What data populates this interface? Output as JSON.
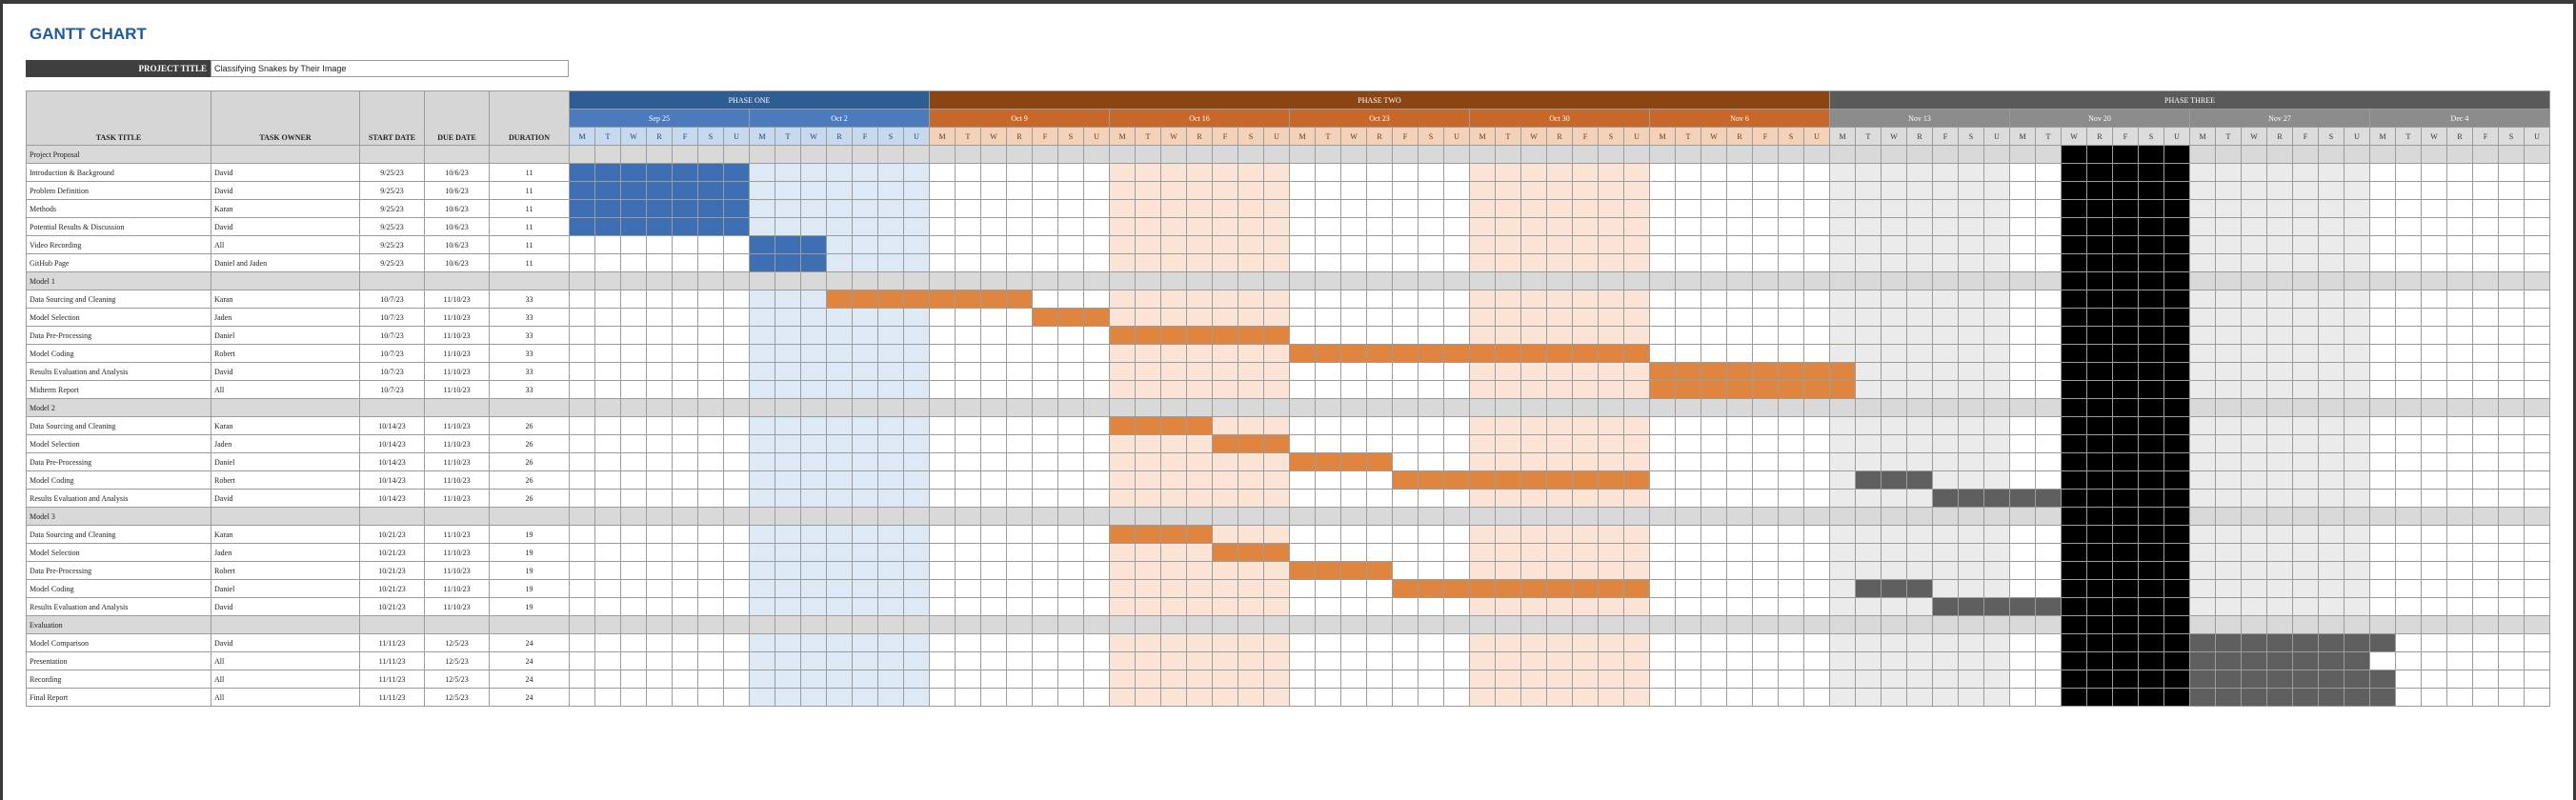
{
  "title": "GANTT CHART",
  "project_title_label": "PROJECT TITLE",
  "project_title_value": "Classifying Snakes by Their Image",
  "columns": {
    "task_title": "TASK TITLE",
    "task_owner": "TASK OWNER",
    "start_date": "START DATE",
    "due_date": "DUE DATE",
    "duration": "DURATION"
  },
  "day_letters": [
    "M",
    "T",
    "W",
    "R",
    "F",
    "S",
    "U"
  ],
  "phases": [
    {
      "label": "PHASE ONE",
      "weeks": 2,
      "style": "ph1"
    },
    {
      "label": "PHASE TWO",
      "weeks": 5,
      "style": "ph2"
    },
    {
      "label": "PHASE THREE",
      "weeks": 4,
      "style": "ph3"
    }
  ],
  "weeks": [
    {
      "label": "Sep 25",
      "phase": 1,
      "col_style": "blue"
    },
    {
      "label": "Oct 2",
      "phase": 1,
      "col_style": "lightblue"
    },
    {
      "label": "Oct 9",
      "phase": 2,
      "col_style": "white"
    },
    {
      "label": "Oct 16",
      "phase": 2,
      "col_style": "peach"
    },
    {
      "label": "Oct 23",
      "phase": 2,
      "col_style": "white"
    },
    {
      "label": "Oct 30",
      "phase": 2,
      "col_style": "peach"
    },
    {
      "label": "Nov 6",
      "phase": 2,
      "col_style": "white"
    },
    {
      "label": "Nov 13",
      "phase": 3,
      "col_style": "gray"
    },
    {
      "label": "Nov 20",
      "phase": 3,
      "col_style": "white"
    },
    {
      "label": "Nov 27",
      "phase": 3,
      "col_style": "gray"
    },
    {
      "label": "Dec 4",
      "phase": 3,
      "col_style": "white"
    }
  ],
  "colors": {
    "phase_one_bar": "#3f6fb3",
    "phase_two_bar": "#e0853f",
    "phase_three_bar": "#5f5f5f",
    "blackout": "#000000",
    "shade_blue": "#dde9f5",
    "shade_peach": "#fbe4d5",
    "shade_gray": "#ebebeb"
  },
  "blackout_days": "Nov 22 - Nov 26",
  "rows": [
    {
      "type": "section",
      "title": "Project Proposal"
    },
    {
      "type": "task",
      "title": "Introduction & Background",
      "owner": "David",
      "start": "9/25/23",
      "due": "10/6/23",
      "duration": "11",
      "bar": [
        0,
        7
      ],
      "color": "phase_one_bar"
    },
    {
      "type": "task",
      "title": "Problem Definition",
      "owner": "David",
      "start": "9/25/23",
      "due": "10/6/23",
      "duration": "11",
      "bar": [
        0,
        7
      ],
      "color": "phase_one_bar"
    },
    {
      "type": "task",
      "title": "Methods",
      "owner": "Karan",
      "start": "9/25/23",
      "due": "10/6/23",
      "duration": "11",
      "bar": [
        0,
        7
      ],
      "color": "phase_one_bar"
    },
    {
      "type": "task",
      "title": "Potential Results & Discussion",
      "owner": "David",
      "start": "9/25/23",
      "due": "10/6/23",
      "duration": "11",
      "bar": [
        0,
        7
      ],
      "color": "phase_one_bar"
    },
    {
      "type": "task",
      "title": "Video Recording",
      "owner": "All",
      "start": "9/25/23",
      "due": "10/6/23",
      "duration": "11",
      "bar": [
        7,
        10
      ],
      "color": "phase_one_bar"
    },
    {
      "type": "task",
      "title": "GitHub Page",
      "owner": "Daniel and Jaden",
      "start": "9/25/23",
      "due": "10/6/23",
      "duration": "11",
      "bar": [
        7,
        10
      ],
      "color": "phase_one_bar"
    },
    {
      "type": "section",
      "title": "Model 1"
    },
    {
      "type": "task",
      "title": "Data Sourcing and Cleaning",
      "owner": "Karan",
      "start": "10/7/23",
      "due": "11/10/23",
      "duration": "33",
      "bar": [
        10,
        18
      ],
      "color": "phase_two_bar"
    },
    {
      "type": "task",
      "title": "Model Selection",
      "owner": "Jaden",
      "start": "10/7/23",
      "due": "11/10/23",
      "duration": "33",
      "bar": [
        18,
        21
      ],
      "color": "phase_two_bar"
    },
    {
      "type": "task",
      "title": "Data Pre-Processing",
      "owner": "Daniel",
      "start": "10/7/23",
      "due": "11/10/23",
      "duration": "33",
      "bar": [
        21,
        28
      ],
      "color": "phase_two_bar"
    },
    {
      "type": "task",
      "title": "Model Coding",
      "owner": "Robert",
      "start": "10/7/23",
      "due": "11/10/23",
      "duration": "33",
      "bar": [
        28,
        42
      ],
      "color": "phase_two_bar"
    },
    {
      "type": "task",
      "title": "Results Evaluation and Analysis",
      "owner": "David",
      "start": "10/7/23",
      "due": "11/10/23",
      "duration": "33",
      "bar": [
        42,
        50
      ],
      "color": "phase_two_bar"
    },
    {
      "type": "task",
      "title": "Midterm Report",
      "owner": "All",
      "start": "10/7/23",
      "due": "11/10/23",
      "duration": "33",
      "bar": [
        42,
        50
      ],
      "color": "phase_two_bar"
    },
    {
      "type": "section",
      "title": "Model 2"
    },
    {
      "type": "task",
      "title": "Data Sourcing and Cleaning",
      "owner": "Karan",
      "start": "10/14/23",
      "due": "11/10/23",
      "duration": "26",
      "bar": [
        21,
        25
      ],
      "color": "phase_two_bar"
    },
    {
      "type": "task",
      "title": "Model Selection",
      "owner": "Jaden",
      "start": "10/14/23",
      "due": "11/10/23",
      "duration": "26",
      "bar": [
        25,
        28
      ],
      "color": "phase_two_bar"
    },
    {
      "type": "task",
      "title": "Data Pre-Processing",
      "owner": "Daniel",
      "start": "10/14/23",
      "due": "11/10/23",
      "duration": "26",
      "bar": [
        28,
        32
      ],
      "color": "phase_two_bar"
    },
    {
      "type": "task",
      "title": "Model Coding",
      "owner": "Robert",
      "start": "10/14/23",
      "due": "11/10/23",
      "duration": "26",
      "bar": [
        32,
        42
      ],
      "color": "phase_two_bar",
      "bar2": [
        50,
        53
      ],
      "color2": "phase_three_bar"
    },
    {
      "type": "task",
      "title": "Results Evaluation and Analysis",
      "owner": "David",
      "start": "10/14/23",
      "due": "11/10/23",
      "duration": "26",
      "bar": [
        53,
        58
      ],
      "color": "phase_three_bar"
    },
    {
      "type": "section",
      "title": "Model 3"
    },
    {
      "type": "task",
      "title": "Data Sourcing and Cleaning",
      "owner": "Karan",
      "start": "10/21/23",
      "due": "11/10/23",
      "duration": "19",
      "bar": [
        21,
        25
      ],
      "color": "phase_two_bar"
    },
    {
      "type": "task",
      "title": "Model Selection",
      "owner": "Jaden",
      "start": "10/21/23",
      "due": "11/10/23",
      "duration": "19",
      "bar": [
        25,
        28
      ],
      "color": "phase_two_bar"
    },
    {
      "type": "task",
      "title": "Data Pre-Processing",
      "owner": "Robert",
      "start": "10/21/23",
      "due": "11/10/23",
      "duration": "19",
      "bar": [
        28,
        32
      ],
      "color": "phase_two_bar"
    },
    {
      "type": "task",
      "title": "Model Coding",
      "owner": "Daniel",
      "start": "10/21/23",
      "due": "11/10/23",
      "duration": "19",
      "bar": [
        32,
        42
      ],
      "color": "phase_two_bar",
      "bar2": [
        50,
        53
      ],
      "color2": "phase_three_bar"
    },
    {
      "type": "task",
      "title": "Results Evaluation and Analysis",
      "owner": "David",
      "start": "10/21/23",
      "due": "11/10/23",
      "duration": "19",
      "bar": [
        53,
        58
      ],
      "color": "phase_three_bar"
    },
    {
      "type": "section",
      "title": "Evaluation"
    },
    {
      "type": "task",
      "title": "Model Comparison",
      "owner": "David",
      "start": "11/11/23",
      "due": "12/5/23",
      "duration": "24",
      "bar": [
        63,
        71
      ],
      "color": "phase_three_bar"
    },
    {
      "type": "task",
      "title": "Presentation",
      "owner": "All",
      "start": "11/11/23",
      "due": "12/5/23",
      "duration": "24",
      "bar": [
        63,
        70
      ],
      "color": "phase_three_bar"
    },
    {
      "type": "task",
      "title": "Recording",
      "owner": "All",
      "start": "11/11/23",
      "due": "12/5/23",
      "duration": "24",
      "bar": [
        63,
        71
      ],
      "color": "phase_three_bar"
    },
    {
      "type": "task",
      "title": "Final Report",
      "owner": "All",
      "start": "11/11/23",
      "due": "12/5/23",
      "duration": "24",
      "bar": [
        63,
        71
      ],
      "color": "phase_three_bar"
    }
  ]
}
